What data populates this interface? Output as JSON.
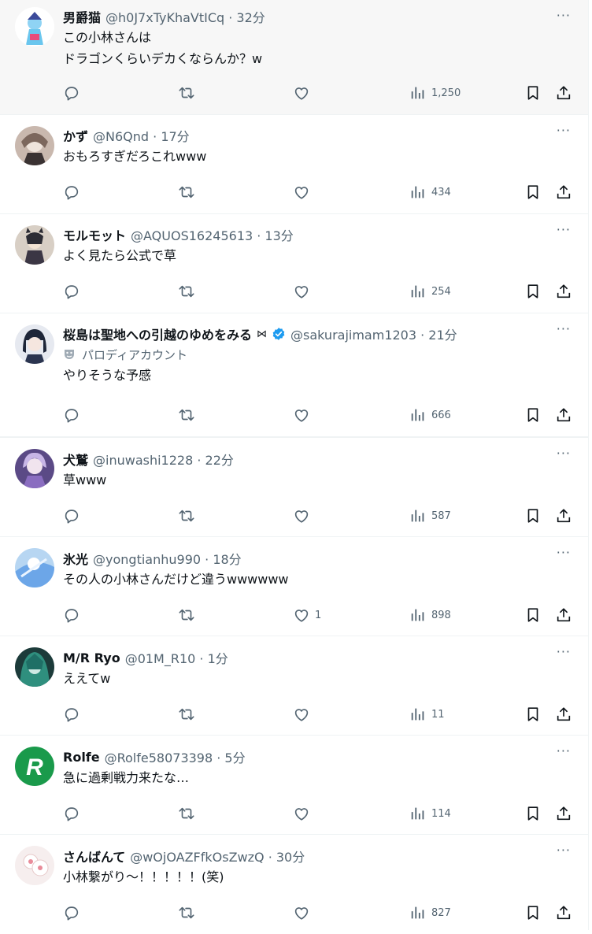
{
  "tweets": [
    {
      "name": "男爵猫",
      "handle": "@h0J7xTyKhaVtICq · 32分",
      "text": "この小林さんは\nドラゴンくらいデカくならんか？w",
      "likes": "",
      "views": "1,250",
      "more": "···"
    },
    {
      "name": "かず",
      "handle": "@N6Qnd · 17分",
      "text": "おもろすぎだろこれwww",
      "likes": "",
      "views": "434",
      "more": "···"
    },
    {
      "name": "モルモット",
      "handle": "@AQUOS16245613 · 13分",
      "text": "よく見たら公式で草",
      "likes": "",
      "views": "254",
      "more": "···"
    },
    {
      "name": "桜島は聖地への引越のゆめをみる",
      "badge": "⋈",
      "handle": "@sakurajimam1203 · 21分",
      "parody": "パロディアカウント",
      "text": "やりそうな予感",
      "likes": "",
      "views": "666",
      "more": "···"
    },
    {
      "name": "犬鷲",
      "handle": "@inuwashi1228 · 22分",
      "text": "草www",
      "likes": "",
      "views": "587",
      "more": "···"
    },
    {
      "name": "氷光",
      "handle": "@yongtianhu990 · 18分",
      "text": "その人の小林さんだけど違うwwwwww",
      "likes": "1",
      "views": "898",
      "more": "···"
    },
    {
      "name": "M/R Ryo",
      "handle": "@01M_R10 · 1分",
      "text": "ええてw",
      "likes": "",
      "views": "11",
      "more": "···"
    },
    {
      "name": "Rolfe",
      "handle": "@Rolfe58073398 · 5分",
      "text": "急に過剰戦力来たな…",
      "likes": "",
      "views": "114",
      "more": "···"
    },
    {
      "name": "さんばんて",
      "handle": "@wOjOAZFfkOsZwzQ · 30分",
      "text": "小林繋がり～！！！！！(笑)",
      "likes": "",
      "views": "827",
      "more": "···"
    }
  ],
  "icons": {
    "reply": "reply-icon",
    "retweet": "retweet-icon",
    "like": "like-icon",
    "views": "views-icon",
    "bookmark": "bookmark-icon",
    "share": "share-icon",
    "verified": "verified-badge-icon",
    "parody": "parody-mask-icon",
    "more": "more-icon"
  },
  "colors": {
    "text": "#0f1419",
    "secondary": "#536471",
    "verified": "#1d9bf0",
    "highlight_bg": "#f7f7f7",
    "border": "#eff3f4"
  }
}
